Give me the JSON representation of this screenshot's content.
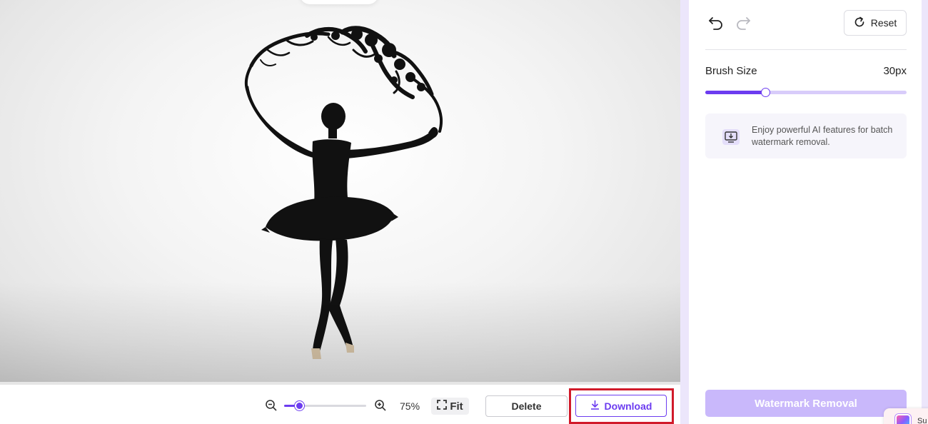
{
  "canvas": {
    "image_description_icon": "ballerina-silhouette-image"
  },
  "toolbar": {
    "zoom_percent": 75,
    "zoom_label": "75%",
    "fit_label": "Fit",
    "delete_label": "Delete",
    "download_label": "Download"
  },
  "panel": {
    "reset_label": "Reset",
    "brush_size_label": "Brush Size",
    "brush_size_value": "30px",
    "brush_size_fraction": 0.3,
    "promo_text": "Enjoy powerful AI features for batch watermark removal.",
    "watermark_removal_label": "Watermark Removal"
  },
  "floating_widget": {
    "text": "Su"
  },
  "colors": {
    "accent": "#6c3cf0",
    "accent_light": "#c9b8fb",
    "highlight": "#d11a2a",
    "panel_bg": "#ece6fb"
  }
}
